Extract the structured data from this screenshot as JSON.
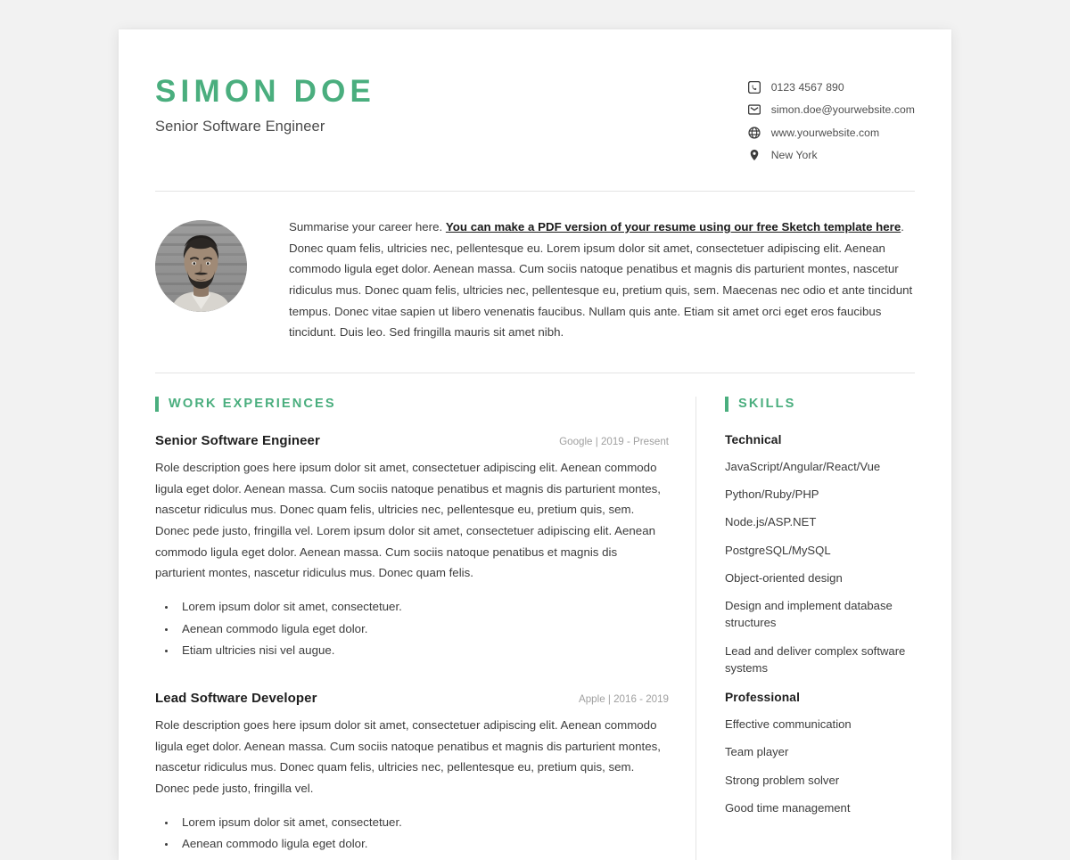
{
  "header": {
    "name": "SIMON DOE",
    "role": "Senior Software Engineer",
    "contacts": [
      {
        "icon": "phone-icon",
        "text": "0123 4567 890"
      },
      {
        "icon": "email-icon",
        "text": "simon.doe@yourwebsite.com"
      },
      {
        "icon": "globe-icon",
        "text": "www.yourwebsite.com"
      },
      {
        "icon": "location-pin-icon",
        "text": "New York"
      }
    ]
  },
  "summary": {
    "lead": "Summarise your career here. ",
    "link": "You can make a PDF version of your resume using our free Sketch template here",
    "rest": ". Donec quam felis, ultricies nec, pellentesque eu. Lorem ipsum dolor sit amet, consectetuer adipiscing elit. Aenean commodo ligula eget dolor. Aenean massa. Cum sociis natoque penatibus et magnis dis parturient montes, nascetur ridiculus mus. Donec quam felis, ultricies nec, pellentesque eu, pretium quis, sem. Maecenas nec odio et ante tincidunt tempus. Donec vitae sapien ut libero venenatis faucibus. Nullam quis ante. Etiam sit amet orci eget eros faucibus tincidunt. Duis leo. Sed fringilla mauris sit amet nibh."
  },
  "work": {
    "section_title": "WORK EXPERIENCES",
    "jobs": [
      {
        "title": "Senior Software Engineer",
        "meta": "Google | 2019 - Present",
        "company": "Google",
        "period": "2019 - Present",
        "description": "Role description goes here ipsum dolor sit amet, consectetuer adipiscing elit. Aenean commodo ligula eget dolor. Aenean massa. Cum sociis natoque penatibus et magnis dis parturient montes, nascetur ridiculus mus. Donec quam felis, ultricies nec, pellentesque eu, pretium quis, sem. Donec pede justo, fringilla vel. Lorem ipsum dolor sit amet, consectetuer adipiscing elit. Aenean commodo ligula eget dolor. Aenean massa. Cum sociis natoque penatibus et magnis dis parturient montes, nascetur ridiculus mus. Donec quam felis.",
        "bullets": [
          "Lorem ipsum dolor sit amet, consectetuer.",
          "Aenean commodo ligula eget dolor.",
          "Etiam ultricies nisi vel augue."
        ]
      },
      {
        "title": "Lead Software Developer",
        "meta": "Apple | 2016 - 2019",
        "company": "Apple",
        "period": "2016 - 2019",
        "description": "Role description goes here ipsum dolor sit amet, consectetuer adipiscing elit. Aenean commodo ligula eget dolor. Aenean massa. Cum sociis natoque penatibus et magnis dis parturient montes, nascetur ridiculus mus. Donec quam felis, ultricies nec, pellentesque eu, pretium quis, sem. Donec pede justo, fringilla vel.",
        "bullets": [
          "Lorem ipsum dolor sit amet, consectetuer.",
          "Aenean commodo ligula eget dolor."
        ]
      }
    ]
  },
  "skills": {
    "section_title": "SKILLS",
    "groups": [
      {
        "title": "Technical",
        "items": [
          "JavaScript/Angular/React/Vue",
          "Python/Ruby/PHP",
          "Node.js/ASP.NET",
          "PostgreSQL/MySQL",
          "Object-oriented design",
          "Design and implement database structures",
          "Lead and deliver complex software systems"
        ]
      },
      {
        "title": "Professional",
        "items": [
          "Effective communication",
          "Team player",
          "Strong problem solver",
          "Good time management"
        ]
      }
    ]
  },
  "colors": {
    "accent": "#4aae7e",
    "text": "#3c3c3c",
    "muted": "#a0a0a0",
    "rule": "#e4e4e4",
    "page_bg": "#ffffff",
    "canvas_bg": "#f2f2f2"
  }
}
